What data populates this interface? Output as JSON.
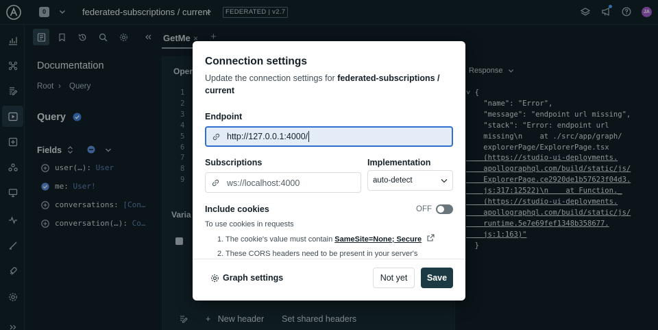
{
  "topbar": {
    "workspace_initial": "0",
    "graph_name": "federated-subscriptions / current",
    "graph_type_badge": "FEDERATED | v2.7",
    "avatar_initials": "JA"
  },
  "tabs": [
    {
      "label": "GetMe",
      "close": "×"
    }
  ],
  "tab_add": "+",
  "documentation": {
    "title": "Documentation",
    "breadcrumb": [
      "Root",
      "Query"
    ],
    "breadcrumb_sep": "›",
    "type_name": "Query",
    "fields_label": "Fields",
    "fields": [
      {
        "name": "user(…): ",
        "type": "User",
        "state": "add"
      },
      {
        "name": "me: ",
        "type": "User!",
        "state": "selected"
      },
      {
        "name": "conversations: ",
        "type": "[Con…",
        "state": "add"
      },
      {
        "name": "conversation(…): ",
        "type": "Co…",
        "state": "add"
      }
    ]
  },
  "operation": {
    "label": "Oper",
    "line_numbers": [
      "1",
      "2",
      "3",
      "4",
      "5",
      "6",
      "7",
      "8",
      "9"
    ],
    "variables_label": "Varia"
  },
  "footer": {
    "new_header": "New header",
    "shared_headers": "Set shared headers"
  },
  "response": {
    "label": "Response",
    "lines": [
      "{",
      "  \"name\": \"Error\",",
      "  \"message\": \"endpoint url missing\",",
      "  \"stack\": \"Error: endpoint url",
      "  missing\\n    at ./src/app/graph/",
      "  explorerPage/ExplorerPage.tsx",
      "  (https://studio-ui-deployments.",
      "  apollographql.com/build/static/js/",
      "  ExplorerPage.ce2920de1b57623f04d3.",
      "  js:317:12522)\\n    at Function._",
      "  (https://studio-ui-deployments.",
      "  apollographql.com/build/static/js/",
      "  runtime.5e7e69fef1348b358677.",
      "  js:1:163)\"",
      "}"
    ]
  },
  "modal": {
    "title": "Connection settings",
    "description_prefix": "Update the connection settings for ",
    "description_graph": "federated-subscriptions / current",
    "endpoint_label": "Endpoint",
    "endpoint_value": "http://127.0.0.1:4000/",
    "subscriptions_label": "Subscriptions",
    "subscriptions_placeholder": "ws://localhost:4000",
    "implementation_label": "Implementation",
    "implementation_value": "auto-detect",
    "include_cookies_label": "Include cookies",
    "include_cookies_state": "OFF",
    "cookies_intro": "To use cookies in requests",
    "cookies_steps": [
      {
        "num": "1.",
        "text": "The cookie's value must contain ",
        "strong": "SameSite=None; Secure"
      },
      {
        "num": "2.",
        "text": "These CORS headers need to be present in your server's",
        "strong": ""
      }
    ],
    "graph_settings": "Graph settings",
    "not_yet": "Not yet",
    "save": "Save"
  },
  "colors": {
    "background": "#0d1a1f",
    "primary_button": "#1b3a44",
    "focus_border": "#2f6fd0",
    "type_link": "#5b7fae"
  }
}
